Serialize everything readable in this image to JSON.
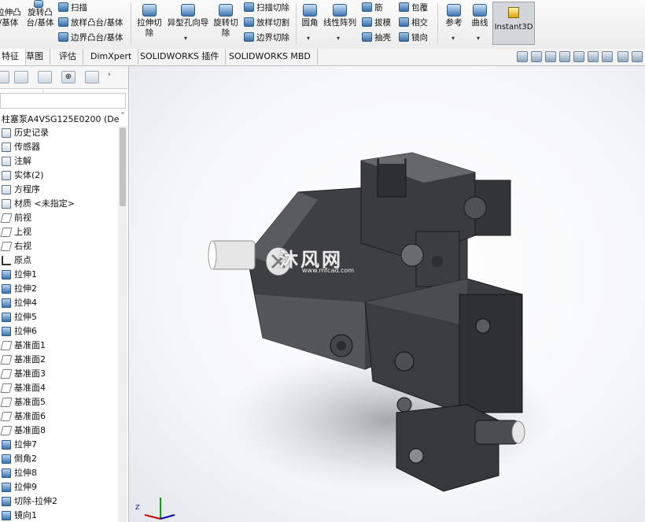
{
  "ribbon": {
    "group1": {
      "extrude_boss_l1": "拉伸凸",
      "extrude_boss_l2": "/基体",
      "revolve_boss_l1": "旋转凸",
      "revolve_boss_l2": "台/基体"
    },
    "group2": {
      "sweep": "扫描",
      "loft": "放样凸台/基体",
      "boundary": "边界凸台/基体"
    },
    "group3": {
      "extruded_cut_l1": "拉伸切",
      "extruded_cut_l2": "除",
      "hole_wizard": "异型孔向导",
      "revolved_cut_l1": "旋转切",
      "revolved_cut_l2": "除"
    },
    "group4": {
      "swept_cut": "扫描切除",
      "lofted_cut": "放样切割",
      "boundary_cut": "边界切除"
    },
    "group5": {
      "fillet": "圆角",
      "linear_pattern": "线性阵列",
      "rib": "筋",
      "draft": "拔模",
      "shell": "抽壳",
      "wrap": "包覆",
      "intersect": "相交",
      "mirror": "镜向"
    },
    "group6": {
      "reference": "参考",
      "curves": "曲线"
    },
    "instant3d": "Instant3D"
  },
  "tabs": [
    "特征",
    "草图",
    "评估",
    "DimXpert",
    "SOLIDWORKS 插件",
    "SOLIDWORKS MBD"
  ],
  "panel": {
    "root": "柱塞泵A4VSG125E0200  (De",
    "tree": [
      {
        "label": "历史记录",
        "icon": "history-folder-icon",
        "kind": "folder"
      },
      {
        "label": "传感器",
        "icon": "sensor-folder-icon",
        "kind": "folder"
      },
      {
        "label": "注解",
        "icon": "annotation-icon",
        "kind": "folder"
      },
      {
        "label": "实体(2)",
        "icon": "solid-bodies-icon",
        "kind": "folder"
      },
      {
        "label": "方程序",
        "icon": "equations-icon",
        "kind": "folder"
      },
      {
        "label": "材质 <未指定>",
        "icon": "material-icon",
        "kind": "folder"
      },
      {
        "label": "前视",
        "icon": "plane-icon",
        "kind": "plane"
      },
      {
        "label": "上视",
        "icon": "plane-icon",
        "kind": "plane"
      },
      {
        "label": "右视",
        "icon": "plane-icon",
        "kind": "plane"
      },
      {
        "label": "原点",
        "icon": "origin-icon",
        "kind": "origin"
      },
      {
        "label": "拉伸1",
        "icon": "extrude-icon",
        "kind": "feat"
      },
      {
        "label": "拉伸2",
        "icon": "extrude-icon",
        "kind": "feat"
      },
      {
        "label": "拉伸4",
        "icon": "extrude-icon",
        "kind": "feat"
      },
      {
        "label": "拉伸5",
        "icon": "extrude-icon",
        "kind": "feat"
      },
      {
        "label": "拉伸6",
        "icon": "extrude-icon",
        "kind": "feat"
      },
      {
        "label": "基准面1",
        "icon": "plane-icon",
        "kind": "plane"
      },
      {
        "label": "基准面2",
        "icon": "plane-icon",
        "kind": "plane"
      },
      {
        "label": "基准面3",
        "icon": "plane-icon",
        "kind": "plane"
      },
      {
        "label": "基准面4",
        "icon": "plane-icon",
        "kind": "plane"
      },
      {
        "label": "基准面5",
        "icon": "plane-icon",
        "kind": "plane"
      },
      {
        "label": "基准面6",
        "icon": "plane-icon",
        "kind": "plane"
      },
      {
        "label": "基准面8",
        "icon": "plane-icon",
        "kind": "plane"
      },
      {
        "label": "拉伸7",
        "icon": "extrude-icon",
        "kind": "feat"
      },
      {
        "label": "倒角2",
        "icon": "chamfer-icon",
        "kind": "feat"
      },
      {
        "label": "拉伸8",
        "icon": "extrude-icon",
        "kind": "feat"
      },
      {
        "label": "拉伸9",
        "icon": "extrude-icon",
        "kind": "feat"
      },
      {
        "label": "切除-拉伸2",
        "icon": "cut-extrude-icon",
        "kind": "feat"
      },
      {
        "label": "镜向1",
        "icon": "mirror-icon",
        "kind": "feat"
      }
    ]
  },
  "viewport": {
    "watermark_text": "沐风网",
    "watermark_url": "www.mfcad.com",
    "triad_axis_label": "Z"
  },
  "colors": {
    "accent": "#3c72ad",
    "model": "#4a4b4e"
  }
}
